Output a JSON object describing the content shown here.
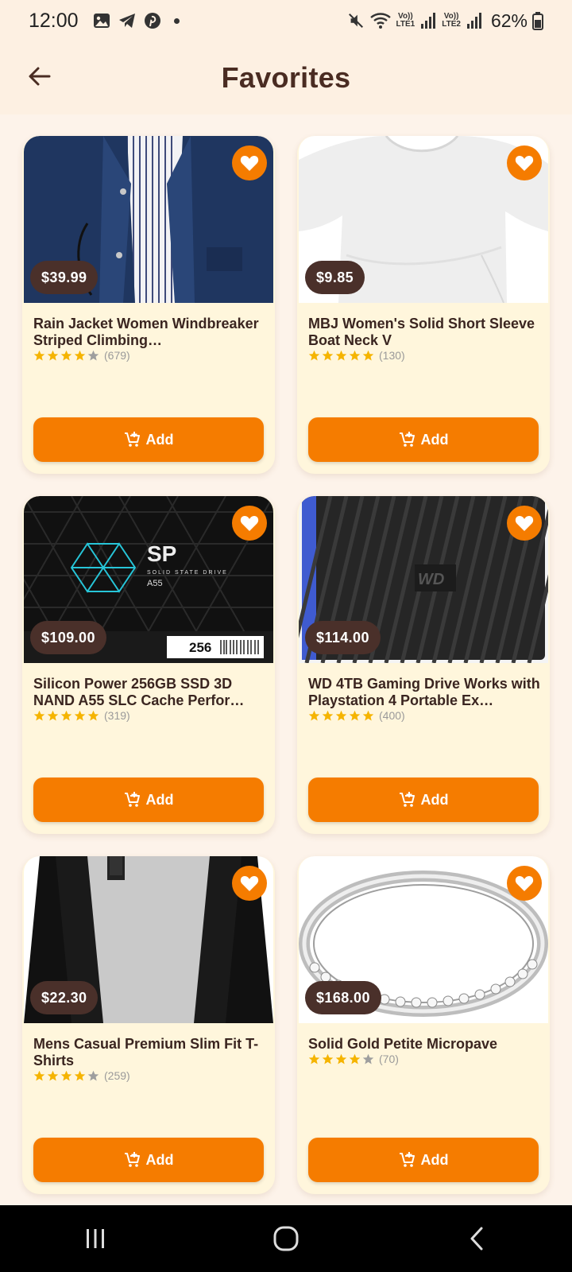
{
  "status_bar": {
    "time": "12:00",
    "left_icons": [
      "gallery-icon",
      "telegram-icon",
      "pinterest-icon"
    ],
    "right_icons": [
      "mute-icon",
      "wifi-icon",
      "signal-lte1-icon",
      "signal-lte2-icon",
      "battery-icon"
    ],
    "lte1": "Vo)) LTE1",
    "lte2": "Vo)) LTE2",
    "battery": "62%"
  },
  "app_bar": {
    "title": "Favorites",
    "back_icon": "arrow-left-icon"
  },
  "colors": {
    "accent": "#f57c00",
    "price_badge": "#4a302a",
    "card_bg": "#fff6dc",
    "page_bg": "#fdf3ea",
    "star": "#f5b400",
    "star_empty": "#9e9e9e"
  },
  "add_label": "Add",
  "products": [
    {
      "title": "Rain Jacket Women Windbreaker Striped Climbing…",
      "price": "$39.99",
      "rating": 4,
      "reviews": "(679)",
      "image": "jacket"
    },
    {
      "title": "MBJ Women's Solid Short Sleeve Boat Neck V",
      "price": "$9.85",
      "rating": 5,
      "reviews": "(130)",
      "image": "tshirt"
    },
    {
      "title": "Silicon Power 256GB SSD 3D NAND A55 SLC Cache Perfor…",
      "price": "$109.00",
      "rating": 5,
      "reviews": "(319)",
      "image": "ssd"
    },
    {
      "title": "WD 4TB Gaming Drive Works with Playstation 4 Portable Ex…",
      "price": "$114.00",
      "rating": 5,
      "reviews": "(400)",
      "image": "hdd"
    },
    {
      "title": "Mens Casual Premium Slim Fit T-Shirts",
      "price": "$22.30",
      "rating": 4,
      "reviews": "(259)",
      "image": "shirt"
    },
    {
      "title": "Solid Gold Petite Micropave",
      "price": "$168.00",
      "rating": 4,
      "reviews": "(70)",
      "image": "ring"
    }
  ],
  "nav": [
    "recent-apps-icon",
    "home-icon",
    "back-icon"
  ]
}
